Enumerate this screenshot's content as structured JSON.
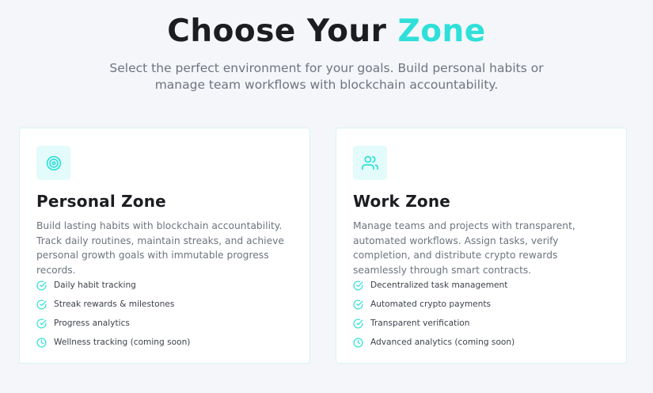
{
  "hero": {
    "title_prefix": "Choose Your ",
    "title_accent": "Zone",
    "subtitle": "Select the perfect environment for your goals. Build personal habits or manage team workflows with blockchain accountability."
  },
  "colors": {
    "accent": "#2ee0d9",
    "icon_bg": "#e3fbfa",
    "card_border": "#d6f5f3"
  },
  "zones": [
    {
      "icon": "target-icon",
      "title": "Personal Zone",
      "description": "Build lasting habits with blockchain accountability. Track daily routines, maintain streaks, and achieve personal growth goals with immutable progress records.",
      "features": [
        {
          "icon": "check-circle-icon",
          "label": "Daily habit tracking"
        },
        {
          "icon": "check-circle-icon",
          "label": "Streak rewards & milestones"
        },
        {
          "icon": "check-circle-icon",
          "label": "Progress analytics"
        },
        {
          "icon": "clock-icon",
          "label": "Wellness tracking (coming soon)"
        }
      ]
    },
    {
      "icon": "users-icon",
      "title": "Work Zone",
      "description": "Manage teams and projects with transparent, automated workflows. Assign tasks, verify completion, and distribute crypto rewards seamlessly through smart contracts.",
      "features": [
        {
          "icon": "check-circle-icon",
          "label": "Decentralized task management"
        },
        {
          "icon": "check-circle-icon",
          "label": "Automated crypto payments"
        },
        {
          "icon": "check-circle-icon",
          "label": "Transparent verification"
        },
        {
          "icon": "clock-icon",
          "label": "Advanced analytics (coming soon)"
        }
      ]
    }
  ]
}
